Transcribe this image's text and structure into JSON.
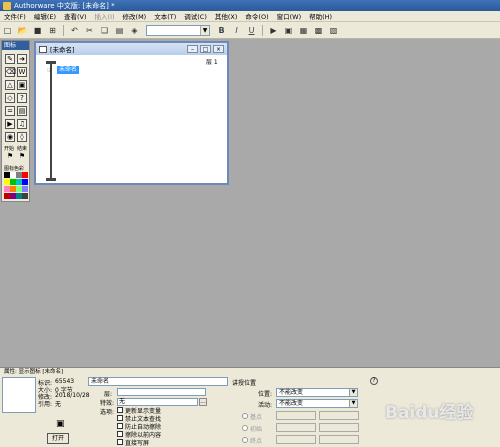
{
  "window": {
    "title": "Authorware 中文版: [未命名] *"
  },
  "menu": {
    "items": [
      {
        "label": "文件(F)",
        "enabled": true
      },
      {
        "label": "编辑(E)",
        "enabled": true
      },
      {
        "label": "查看(V)",
        "enabled": true
      },
      {
        "label": "插入(I)",
        "enabled": false
      },
      {
        "label": "修改(M)",
        "enabled": true
      },
      {
        "label": "文本(T)",
        "enabled": true
      },
      {
        "label": "调试(C)",
        "enabled": true
      },
      {
        "label": "其他(X)",
        "enabled": true
      },
      {
        "label": "命令(O)",
        "enabled": true
      },
      {
        "label": "窗口(W)",
        "enabled": true
      },
      {
        "label": "帮助(H)",
        "enabled": true
      }
    ]
  },
  "toolbar": {
    "icons": [
      "new-file",
      "open-file",
      "save",
      "import",
      "undo",
      "cut",
      "copy",
      "paste",
      "find"
    ],
    "bold": "B",
    "italic": "I",
    "underline": "U",
    "right_icons": [
      "run",
      "control-panel",
      "functions",
      "variables",
      "knowledge-objects"
    ]
  },
  "palette": {
    "title": "图标",
    "start_label": "开始",
    "end_label": "结束",
    "color_label": "图标色彩",
    "swatches": [
      "#000000",
      "#ffffff",
      "#808080",
      "#ff0000",
      "#ffff00",
      "#00c000",
      "#00c0c0",
      "#0000ff",
      "#ff80c0",
      "#ff8000",
      "#80ff80",
      "#8080ff",
      "#c00000",
      "#800080",
      "#008080",
      "#404040"
    ]
  },
  "flow": {
    "title": "[未命名]",
    "icon_name": "未命名",
    "layer_label": "层 1"
  },
  "props": {
    "header": "属性: 显示图标 [未命名]",
    "tag_label": "标识:",
    "tag_value": "65543",
    "size_label": "大小:",
    "size_value": "0 字节",
    "modified_label": "修改:",
    "modified_value": "2018/10/28",
    "ref_label": "引用:",
    "ref_value": "无",
    "name_value": "未命名",
    "layer_label": "层:",
    "effect_label": "特效:",
    "effect_value": "无",
    "options_label": "选项:",
    "options": [
      "更新显示变量",
      "禁止文本查找",
      "防止自动擦除",
      "擦除以前内容",
      "直接写屏"
    ],
    "open_button": "打开",
    "mode_label": "讲授位置",
    "position_label": "位置:",
    "position_value": "不能改变",
    "movable_label": "活动:",
    "movable_value": "不能改变",
    "base_label": "基点",
    "init_label": "初始",
    "end_label": "终点",
    "help_icon": "?"
  },
  "watermark": "Baidu经验"
}
